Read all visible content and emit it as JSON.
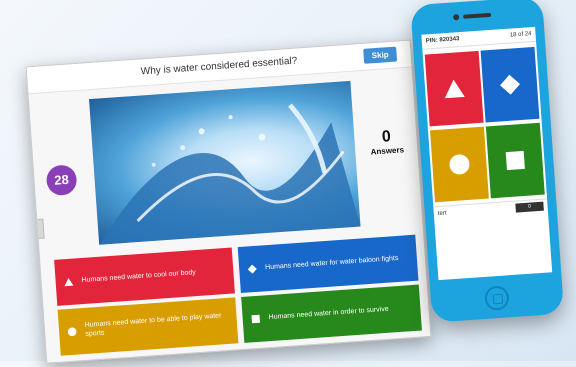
{
  "question": {
    "text": "Why is water considered essential?",
    "skip_label": "Skip"
  },
  "timer": {
    "value": "28"
  },
  "answer_count": {
    "number": "0",
    "label": "Answers"
  },
  "answers": [
    {
      "text": "Humans need water to cool our body",
      "shape": "triangle",
      "color": "#e2253a"
    },
    {
      "text": "Humans need water for water baloon fights",
      "shape": "diamond",
      "color": "#1868cb"
    },
    {
      "text": "Humans need water to be able to play water sports",
      "shape": "circle",
      "color": "#d89e00"
    },
    {
      "text": "Humans need water in order to survive",
      "shape": "square",
      "color": "#27891c"
    }
  ],
  "phone": {
    "pin_label": "PIN: 820343",
    "progress": "18 of 24",
    "nickname": "tert",
    "score": "0"
  }
}
